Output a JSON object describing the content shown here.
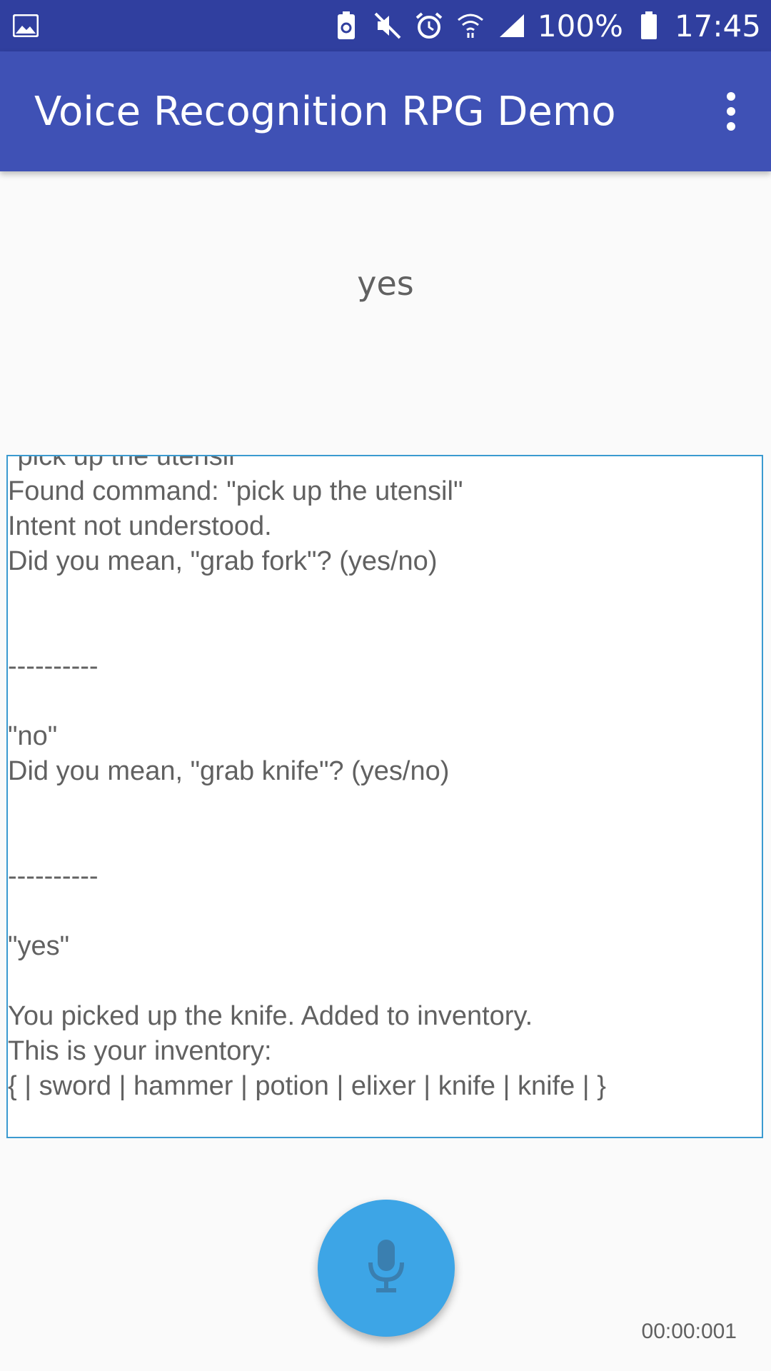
{
  "status_bar": {
    "battery": "100%",
    "time": "17:45",
    "icons": [
      "image-icon",
      "battery-saver-icon",
      "mute-icon",
      "alarm-icon",
      "wifi-icon",
      "signal-icon",
      "battery-icon"
    ]
  },
  "app_bar": {
    "title": "Voice Recognition RPG Demo",
    "menu_icon": "more-vert-icon"
  },
  "recognized_text": "yes",
  "log": {
    "lines": [
      "\"pick up the utensil\"",
      "Found command: \"pick up the utensil\"",
      "Intent not understood.",
      "Did you mean, \"grab fork\"? (yes/no)",
      "",
      "",
      "----------",
      "",
      "\"no\"",
      "Did you mean, \"grab knife\"? (yes/no)",
      "",
      "",
      "----------",
      "",
      "\"yes\"",
      "",
      "You picked up the knife. Added to inventory.",
      "This is your inventory:",
      "{ | sword | hammer | potion | elixer | knife | knife | }"
    ]
  },
  "mic_button": {
    "icon": "microphone-icon"
  },
  "timer": "00:00:001",
  "colors": {
    "status_bar": "#303f9f",
    "app_bar": "#3f51b5",
    "fab": "#3da5e6",
    "log_border": "#3b9ad0"
  }
}
